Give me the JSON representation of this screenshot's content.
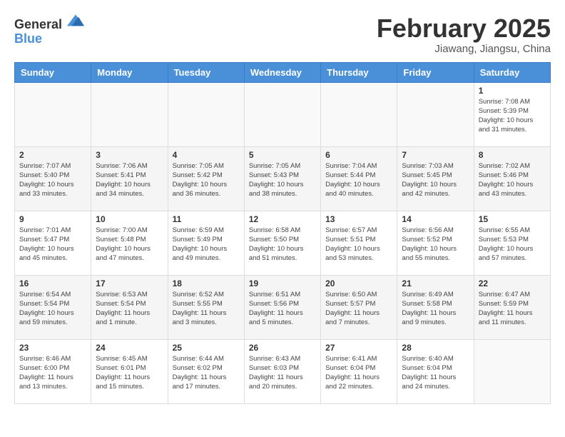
{
  "logo": {
    "general": "General",
    "blue": "Blue"
  },
  "title": "February 2025",
  "subtitle": "Jiawang, Jiangsu, China",
  "days_of_week": [
    "Sunday",
    "Monday",
    "Tuesday",
    "Wednesday",
    "Thursday",
    "Friday",
    "Saturday"
  ],
  "weeks": [
    [
      {
        "day": "",
        "info": ""
      },
      {
        "day": "",
        "info": ""
      },
      {
        "day": "",
        "info": ""
      },
      {
        "day": "",
        "info": ""
      },
      {
        "day": "",
        "info": ""
      },
      {
        "day": "",
        "info": ""
      },
      {
        "day": "1",
        "info": "Sunrise: 7:08 AM\nSunset: 5:39 PM\nDaylight: 10 hours and 31 minutes."
      }
    ],
    [
      {
        "day": "2",
        "info": "Sunrise: 7:07 AM\nSunset: 5:40 PM\nDaylight: 10 hours and 33 minutes."
      },
      {
        "day": "3",
        "info": "Sunrise: 7:06 AM\nSunset: 5:41 PM\nDaylight: 10 hours and 34 minutes."
      },
      {
        "day": "4",
        "info": "Sunrise: 7:05 AM\nSunset: 5:42 PM\nDaylight: 10 hours and 36 minutes."
      },
      {
        "day": "5",
        "info": "Sunrise: 7:05 AM\nSunset: 5:43 PM\nDaylight: 10 hours and 38 minutes."
      },
      {
        "day": "6",
        "info": "Sunrise: 7:04 AM\nSunset: 5:44 PM\nDaylight: 10 hours and 40 minutes."
      },
      {
        "day": "7",
        "info": "Sunrise: 7:03 AM\nSunset: 5:45 PM\nDaylight: 10 hours and 42 minutes."
      },
      {
        "day": "8",
        "info": "Sunrise: 7:02 AM\nSunset: 5:46 PM\nDaylight: 10 hours and 43 minutes."
      }
    ],
    [
      {
        "day": "9",
        "info": "Sunrise: 7:01 AM\nSunset: 5:47 PM\nDaylight: 10 hours and 45 minutes."
      },
      {
        "day": "10",
        "info": "Sunrise: 7:00 AM\nSunset: 5:48 PM\nDaylight: 10 hours and 47 minutes."
      },
      {
        "day": "11",
        "info": "Sunrise: 6:59 AM\nSunset: 5:49 PM\nDaylight: 10 hours and 49 minutes."
      },
      {
        "day": "12",
        "info": "Sunrise: 6:58 AM\nSunset: 5:50 PM\nDaylight: 10 hours and 51 minutes."
      },
      {
        "day": "13",
        "info": "Sunrise: 6:57 AM\nSunset: 5:51 PM\nDaylight: 10 hours and 53 minutes."
      },
      {
        "day": "14",
        "info": "Sunrise: 6:56 AM\nSunset: 5:52 PM\nDaylight: 10 hours and 55 minutes."
      },
      {
        "day": "15",
        "info": "Sunrise: 6:55 AM\nSunset: 5:53 PM\nDaylight: 10 hours and 57 minutes."
      }
    ],
    [
      {
        "day": "16",
        "info": "Sunrise: 6:54 AM\nSunset: 5:54 PM\nDaylight: 10 hours and 59 minutes."
      },
      {
        "day": "17",
        "info": "Sunrise: 6:53 AM\nSunset: 5:54 PM\nDaylight: 11 hours and 1 minute."
      },
      {
        "day": "18",
        "info": "Sunrise: 6:52 AM\nSunset: 5:55 PM\nDaylight: 11 hours and 3 minutes."
      },
      {
        "day": "19",
        "info": "Sunrise: 6:51 AM\nSunset: 5:56 PM\nDaylight: 11 hours and 5 minutes."
      },
      {
        "day": "20",
        "info": "Sunrise: 6:50 AM\nSunset: 5:57 PM\nDaylight: 11 hours and 7 minutes."
      },
      {
        "day": "21",
        "info": "Sunrise: 6:49 AM\nSunset: 5:58 PM\nDaylight: 11 hours and 9 minutes."
      },
      {
        "day": "22",
        "info": "Sunrise: 6:47 AM\nSunset: 5:59 PM\nDaylight: 11 hours and 11 minutes."
      }
    ],
    [
      {
        "day": "23",
        "info": "Sunrise: 6:46 AM\nSunset: 6:00 PM\nDaylight: 11 hours and 13 minutes."
      },
      {
        "day": "24",
        "info": "Sunrise: 6:45 AM\nSunset: 6:01 PM\nDaylight: 11 hours and 15 minutes."
      },
      {
        "day": "25",
        "info": "Sunrise: 6:44 AM\nSunset: 6:02 PM\nDaylight: 11 hours and 17 minutes."
      },
      {
        "day": "26",
        "info": "Sunrise: 6:43 AM\nSunset: 6:03 PM\nDaylight: 11 hours and 20 minutes."
      },
      {
        "day": "27",
        "info": "Sunrise: 6:41 AM\nSunset: 6:04 PM\nDaylight: 11 hours and 22 minutes."
      },
      {
        "day": "28",
        "info": "Sunrise: 6:40 AM\nSunset: 6:04 PM\nDaylight: 11 hours and 24 minutes."
      },
      {
        "day": "",
        "info": ""
      }
    ]
  ]
}
